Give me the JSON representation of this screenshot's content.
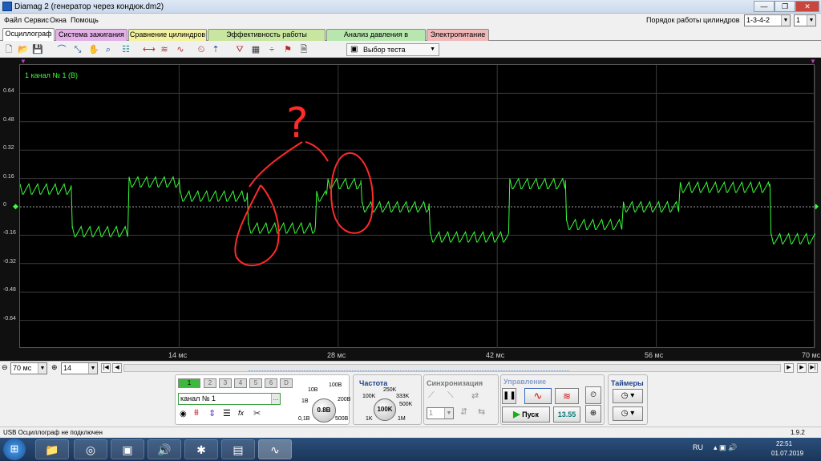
{
  "window": {
    "title": "Diamag 2 (генератор через кондюк.dm2)",
    "min": "—",
    "restore": "❐",
    "close": "✕"
  },
  "menu": [
    "Файл",
    "Сервис",
    "Окна",
    "Помощь"
  ],
  "order": {
    "label": "Порядок работы цилиндров",
    "value": "1-3-4-2",
    "count": "1"
  },
  "tabs": [
    {
      "label": "Осциллограф",
      "color": "#ffffff"
    },
    {
      "label": "Система зажигания",
      "color": "#e3b1e8"
    },
    {
      "label": "Сравнение цилиндров",
      "color": "#f3f2a0"
    },
    {
      "label": "Эффективность работы цилиндров",
      "color": "#c8e6a0"
    },
    {
      "label": "Анализ давления в цилиндре",
      "color": "#b7e7ae"
    },
    {
      "label": "Электропитание",
      "color": "#f1b8b8"
    }
  ],
  "toolbar": {
    "test_select": "Выбор теста"
  },
  "scope": {
    "channel_label": "1  канал № 1 (В)",
    "trace_color": "#38ff38",
    "annotation_color": "#ff2a2a",
    "annotation_text": "?"
  },
  "chart_data": {
    "type": "line",
    "title": "",
    "xlabel": "",
    "ylabel": "",
    "xlim": [
      0,
      70
    ],
    "ylim": [
      -0.8,
      0.8
    ],
    "x_ticks": [
      "14 мс",
      "28 мс",
      "42 мс",
      "56 мс",
      "70 мс"
    ],
    "x_tick_values": [
      14,
      28,
      42,
      56,
      70
    ],
    "y_ticks": [
      "0.64",
      "0.48",
      "0.32",
      "0.16",
      "0",
      "-0.16",
      "-0.32",
      "-0.48",
      "-0.64"
    ],
    "y_tick_values": [
      0.64,
      0.48,
      0.32,
      0.16,
      0,
      -0.16,
      -0.32,
      -0.48,
      -0.64
    ],
    "series": [
      {
        "name": "канал № 1",
        "x": [
          0,
          4.5,
          4.6,
          9.5,
          9.6,
          14,
          14.1,
          20,
          20.1,
          26,
          26.1,
          27,
          27.1,
          30,
          30.1,
          36,
          36.1,
          43,
          43.1,
          48,
          48.1,
          53,
          53.1,
          58,
          58.1,
          66,
          66.1,
          70
        ],
        "y": [
          0.12,
          0.12,
          -0.12,
          -0.12,
          0.16,
          0.16,
          0.08,
          0.08,
          -0.1,
          -0.1,
          0.08,
          0.08,
          0.15,
          0.15,
          0.02,
          0.02,
          -0.15,
          -0.15,
          0.15,
          0.15,
          -0.08,
          -0.08,
          0.02,
          0.02,
          0.13,
          0.13,
          -0.16,
          -0.16
        ]
      }
    ]
  },
  "hscroll": {
    "zoom_value": "70 мс",
    "step_value": "14"
  },
  "channels": [
    "1",
    "2",
    "3",
    "4",
    "5",
    "6",
    "D"
  ],
  "controls": {
    "channel_name": "канал № 1",
    "range_knob": "0.8В",
    "range_labels": [
      "10В",
      "100В",
      "1В",
      "200В",
      "0,1В",
      "500В"
    ],
    "freq_title": "Частота",
    "freq_knob": "100K",
    "freq_labels": [
      "250K",
      "100K",
      "333K",
      "500K",
      "1K",
      "1M"
    ],
    "sync_title": "Синхронизация",
    "sync_value": "1",
    "control_title": "Управление",
    "start_button": "Пуск",
    "time_value": "13.55",
    "timers_title": "Таймеры"
  },
  "status": {
    "text": "USB Осциллограф не подключен",
    "version": "1.9.2"
  },
  "taskbar": {
    "lang": "RU",
    "time": "22:51",
    "date": "01.07.2019"
  }
}
